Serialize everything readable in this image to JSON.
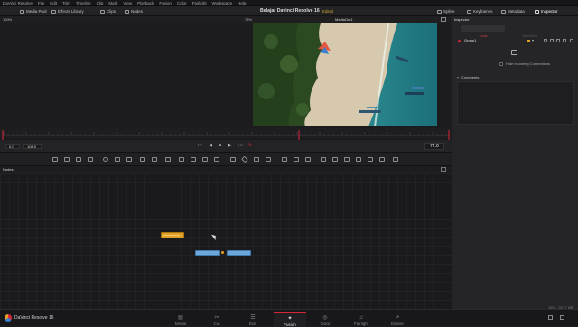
{
  "menubar": {
    "items": [
      "DaVinci Resolve",
      "File",
      "Edit",
      "Trim",
      "Timeline",
      "Clip",
      "Mark",
      "View",
      "Playback",
      "Fusion",
      "Color",
      "Fairlight",
      "Workspace",
      "Help"
    ]
  },
  "toolbar": {
    "media_pool": "Media Pool",
    "effects_library": "Effects Library",
    "clips": "Clips",
    "nodes": "Nodes",
    "project_title": "Belajar Davinci Resolve 16",
    "edited": "Edited",
    "spline": "Spline",
    "keyframes": "Keyframes",
    "metadata": "Metadata",
    "inspector": "Inspector"
  },
  "viewer": {
    "zoom": "100%",
    "zoom_right": "75%",
    "title": "MediaOut1"
  },
  "transport": {
    "start_value": "0.0",
    "end_value": "108.0",
    "current_frame": "72.0"
  },
  "nodes_panel": {
    "title": "Nodes"
  },
  "inspector": {
    "title": "Inspector",
    "tabs": [
      "Tools",
      "Modifiers"
    ],
    "group_name": "Group1",
    "hide_connections": "Hide Incoming Connections",
    "comments": "Comments"
  },
  "statusbar": {
    "app_name": "DaVinci Resolve 16",
    "pages": [
      {
        "label": "Media",
        "icon": "media-page-icon"
      },
      {
        "label": "Cut",
        "icon": "cut-page-icon"
      },
      {
        "label": "Edit",
        "icon": "edit-page-icon"
      },
      {
        "label": "Fusion",
        "icon": "fusion-page-icon"
      },
      {
        "label": "Color",
        "icon": "color-page-icon"
      },
      {
        "label": "Fairlight",
        "icon": "fairlight-page-icon"
      },
      {
        "label": "Deliver",
        "icon": "deliver-page-icon"
      }
    ],
    "active_page": "Fusion",
    "usage": "15% - 3277 MB"
  },
  "colors": {
    "accent_red": "#d8273c",
    "node_blue": "#6ea7d8",
    "node_orange": "#e1a028",
    "edited_gold": "#c9a230"
  }
}
